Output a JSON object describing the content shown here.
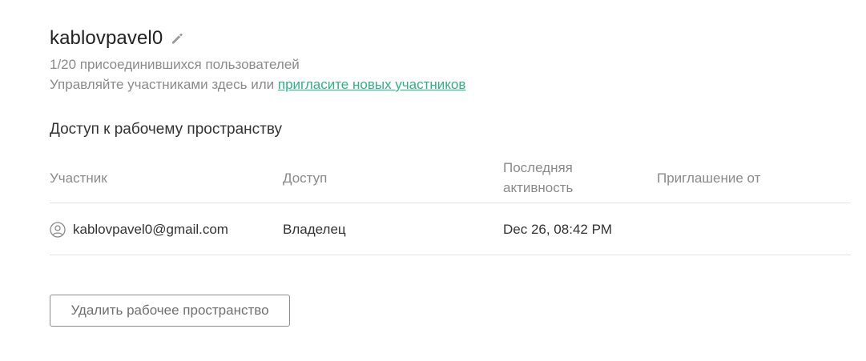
{
  "workspace": {
    "name": "kablovpavel0",
    "members_count_text": "1/20 присоединившихся пользователей",
    "manage_text": "Управляйте участниками здесь или ",
    "invite_link_text": "пригласите новых участников"
  },
  "icons": {
    "edit": "pencil-icon",
    "member": "user-circle-icon"
  },
  "colors": {
    "link": "#2fb184",
    "text_primary": "#222222",
    "text_muted": "#8a8a8a",
    "divider": "#e3e3e3"
  },
  "access_section": {
    "title": "Доступ к рабочему пространству",
    "columns": {
      "member": "Участник",
      "access": "Доступ",
      "last_activity_line1": "Последняя",
      "last_activity_line2": "активность",
      "invited_by": "Приглашение от"
    },
    "rows": [
      {
        "member": "kablovpavel0@gmail.com",
        "access": "Владелец",
        "last_activity": "Dec 26, 08:42 PM",
        "invited_by": ""
      }
    ]
  },
  "actions": {
    "delete_workspace_label": "Удалить рабочее пространство"
  }
}
